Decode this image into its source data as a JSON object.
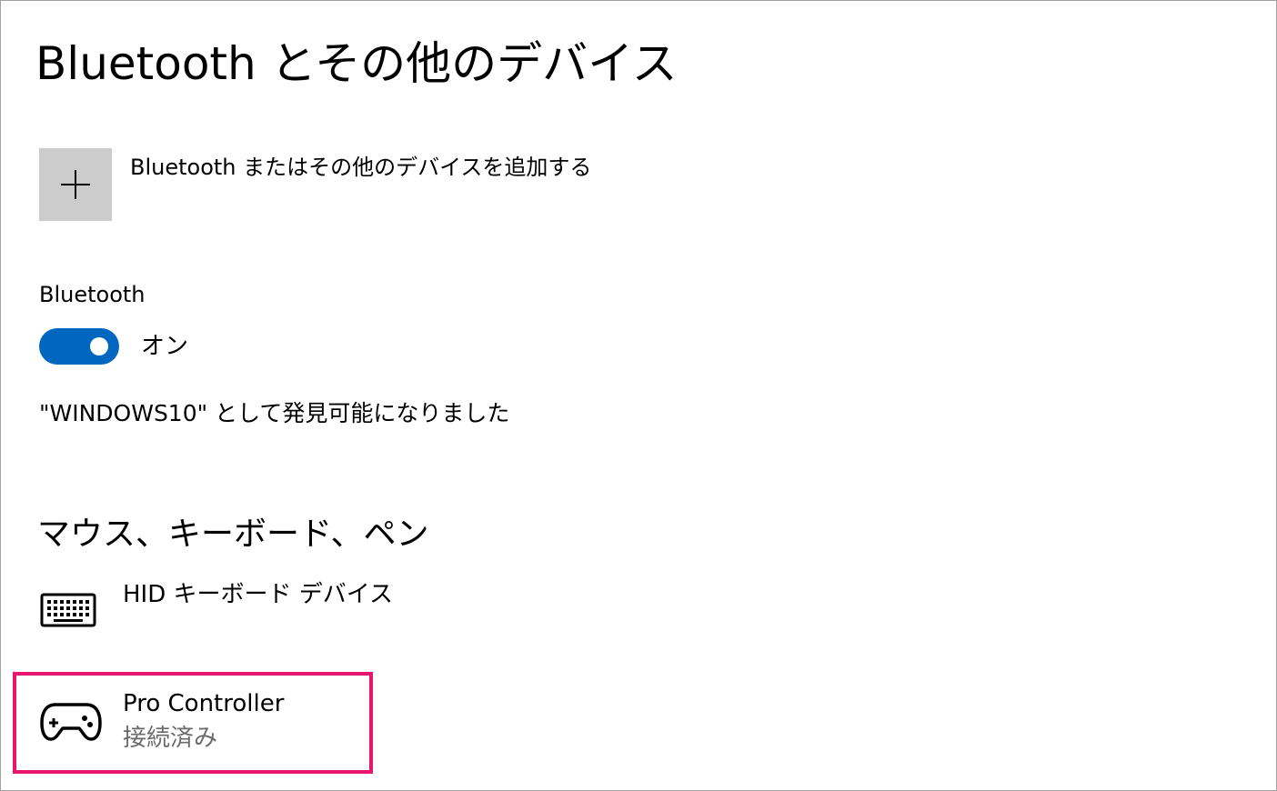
{
  "page": {
    "title": "Bluetooth とその他のデバイス"
  },
  "add_device": {
    "label": "Bluetooth またはその他のデバイスを追加する",
    "icon": "plus-icon"
  },
  "bluetooth": {
    "label": "Bluetooth",
    "toggle_state": "オン",
    "toggle_on": true,
    "discoverable_text": "\"WINDOWS10\" として発見可能になりました"
  },
  "section": {
    "heading": "マウス、キーボード、ペン"
  },
  "devices": [
    {
      "name": "HID キーボード デバイス",
      "status": "",
      "icon": "keyboard-icon"
    },
    {
      "name": "Pro Controller",
      "status": "接続済み",
      "icon": "gamepad-icon"
    }
  ],
  "colors": {
    "accent": "#0067c0",
    "highlight": "#e8176d",
    "tile": "#cccccc",
    "secondary_text": "#6a6a6a"
  }
}
